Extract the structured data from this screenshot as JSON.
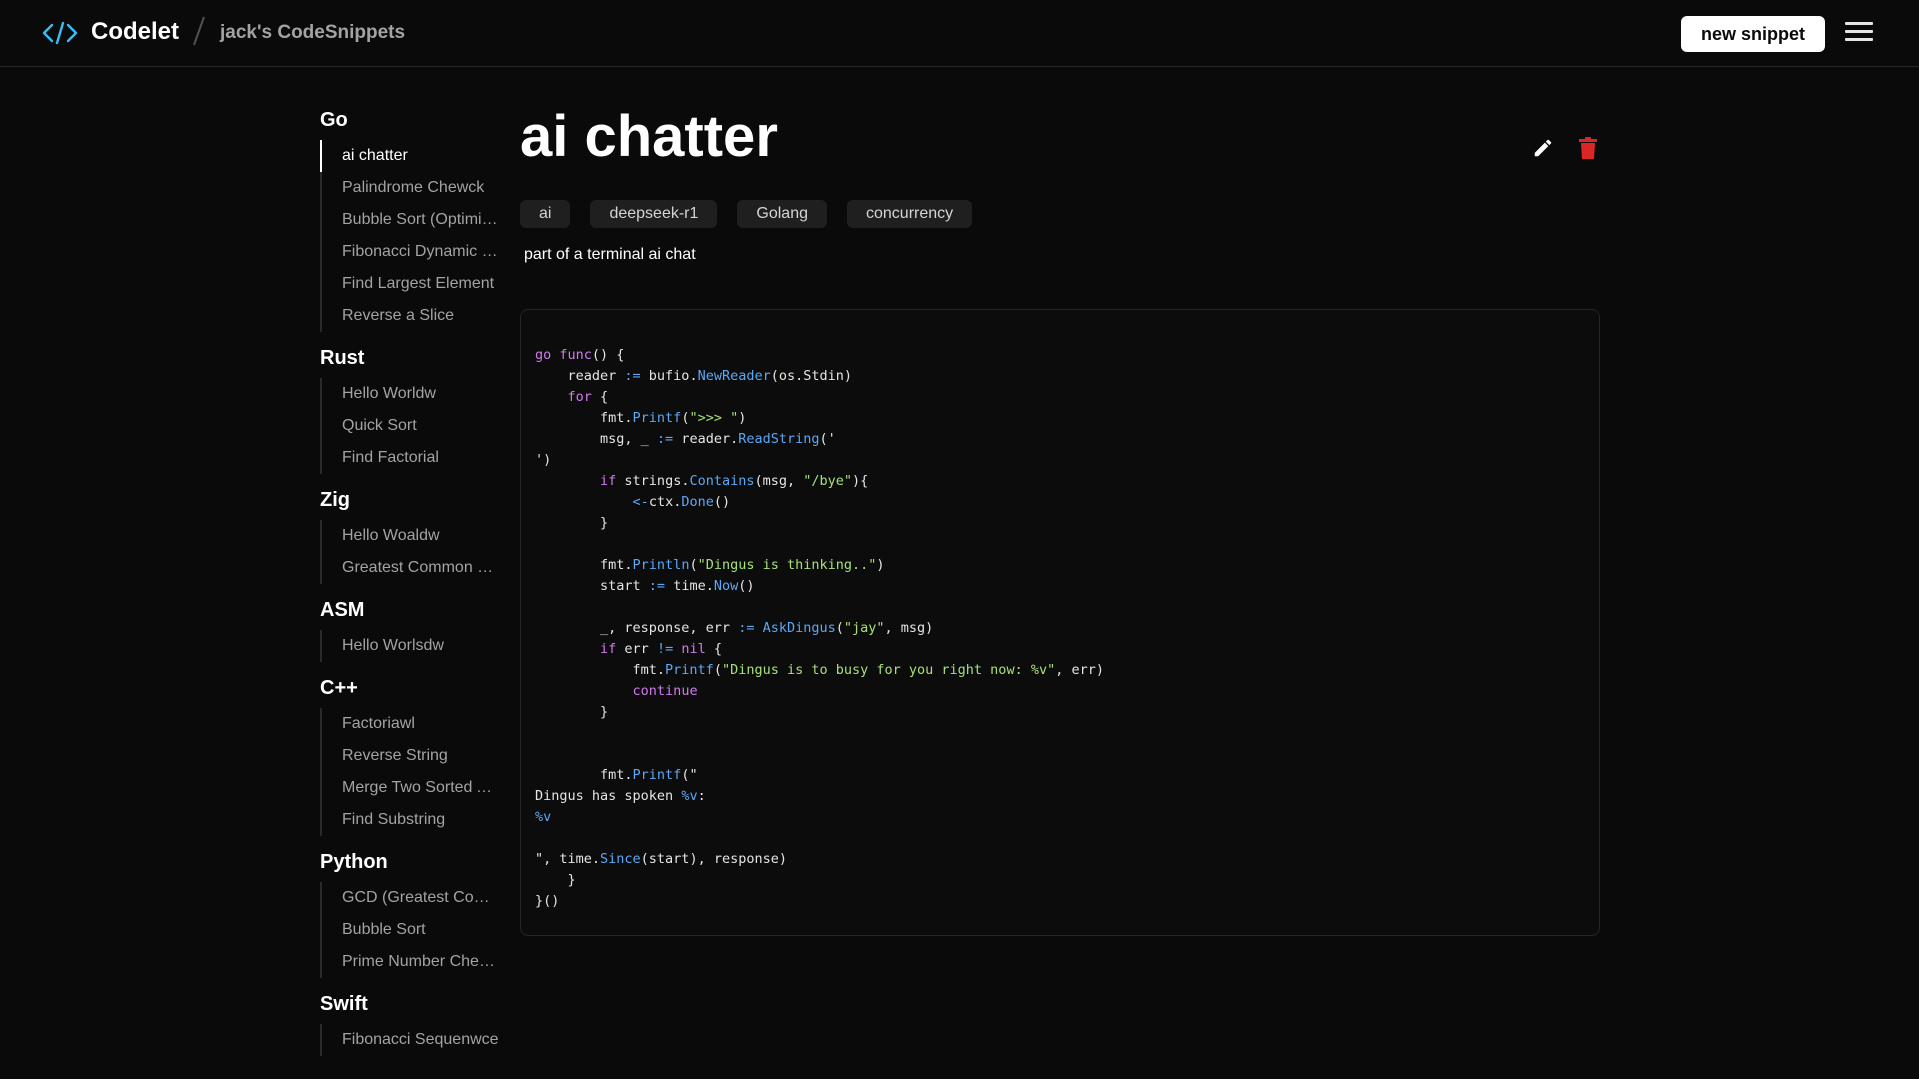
{
  "header": {
    "brand": "Codelet",
    "breadcrumb": "jack's CodeSnippets",
    "new_snippet_label": "new snippet"
  },
  "sidebar": {
    "groups": [
      {
        "title": "Go",
        "items": [
          "ai chatter",
          "Palindrome Chewck",
          "Bubble Sort (Optimized)",
          "Fibonacci Dynamic Programming",
          "Find Largest Element",
          "Reverse a Slice"
        ]
      },
      {
        "title": "Rust",
        "items": [
          "Hello Worldw",
          "Quick Sort",
          "Find Factorial"
        ]
      },
      {
        "title": "Zig",
        "items": [
          "Hello Woaldw",
          "Greatest Common Divisor"
        ]
      },
      {
        "title": "ASM",
        "items": [
          "Hello Worlsdw"
        ]
      },
      {
        "title": "C++",
        "items": [
          "Factoriawl",
          "Reverse String",
          "Merge Two Sorted Arrays",
          "Find Substring"
        ]
      },
      {
        "title": "Python",
        "items": [
          "GCD (Greatest Common Divisor)",
          "Bubble Sort",
          "Prime Number Checker"
        ]
      },
      {
        "title": "Swift",
        "items": [
          "Fibonacci Sequenwce"
        ]
      }
    ]
  },
  "snippet": {
    "title": "ai chatter",
    "tags": [
      "ai",
      "deepseek-r1",
      "Golang",
      "concurrency"
    ],
    "description": "part of a terminal ai chat"
  },
  "icons": {
    "logo": "code-brackets-icon",
    "edit": "pencil-icon",
    "delete": "trash-icon",
    "menu": "hamburger-menu-icon"
  },
  "colors": {
    "background": "#0a0a0a",
    "logo_accent": "#38bdf8",
    "delete": "#dc2626",
    "keyword": "#d27af0",
    "function": "#5ba8f5",
    "string": "#a6e07a"
  }
}
